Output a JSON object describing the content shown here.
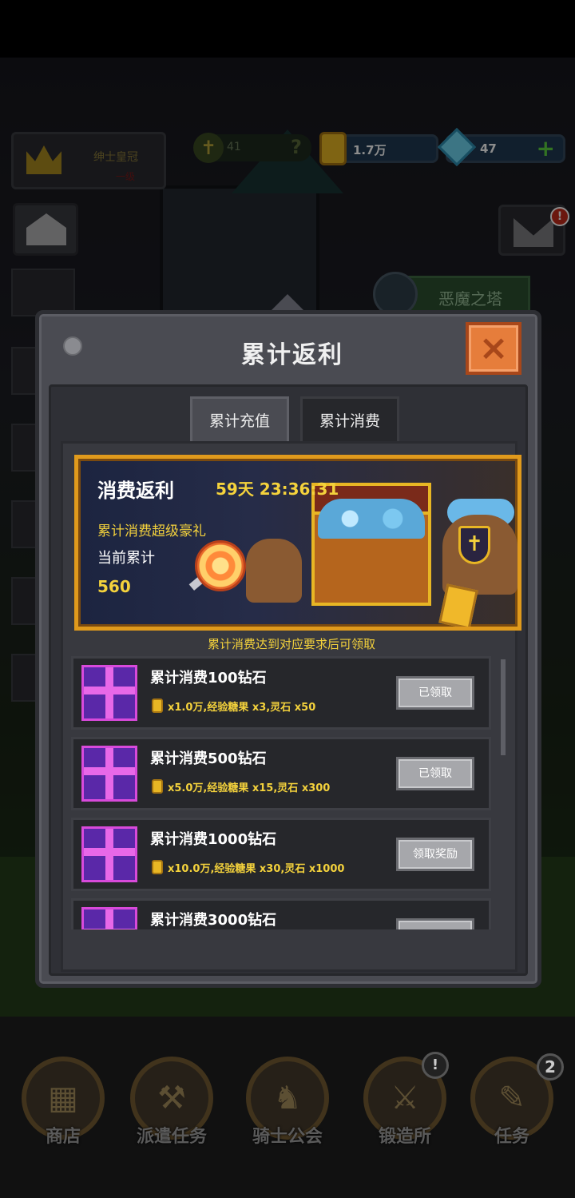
{
  "hud": {
    "rank_title": "绅士皇冠",
    "rank_sub": "一级",
    "power": "41",
    "power_help": "?",
    "gold": "1.7万",
    "gems": "47",
    "gem_add": "+",
    "mail_badge": "!",
    "tower_label": "恶魔之塔"
  },
  "modal": {
    "title": "累计返利",
    "close": "×",
    "tabs": [
      {
        "label": "累计充值",
        "active": true
      },
      {
        "label": "累计消费",
        "active": false
      }
    ],
    "banner": {
      "title": "消费返利",
      "timer": "59天 23:36:31",
      "desc": "累计消费超级豪礼",
      "current_label": "当前累计",
      "current_value": "560"
    },
    "hint": "累计消费达到对应要求后可领取",
    "rewards": [
      {
        "title": "累计消费100钻石",
        "reward": "x1.0万,经验糖果 x3,灵石 x50",
        "button": "已领取"
      },
      {
        "title": "累计消费500钻石",
        "reward": "x5.0万,经验糖果 x15,灵石 x300",
        "button": "已领取"
      },
      {
        "title": "累计消费1000钻石",
        "reward": "x10.0万,经验糖果 x30,灵石 x1000",
        "button": "领取奖励"
      },
      {
        "title": "累计消费3000钻石",
        "reward": "",
        "button": ""
      }
    ]
  },
  "nav": {
    "items": [
      {
        "label": "商店",
        "icon": "shop-icon"
      },
      {
        "label": "派遣任务",
        "icon": "dispatch-icon"
      },
      {
        "label": "骑士公会",
        "icon": "knight-guild-icon"
      },
      {
        "label": "锻造所",
        "icon": "forge-icon"
      },
      {
        "label": "任务",
        "icon": "quest-icon"
      }
    ],
    "forge_badge": "!",
    "quest_badge": "2"
  },
  "colors": {
    "accent_gold": "#f4d23c",
    "close_orange": "#e67d3b",
    "gift_purple": "#5a28a8"
  }
}
